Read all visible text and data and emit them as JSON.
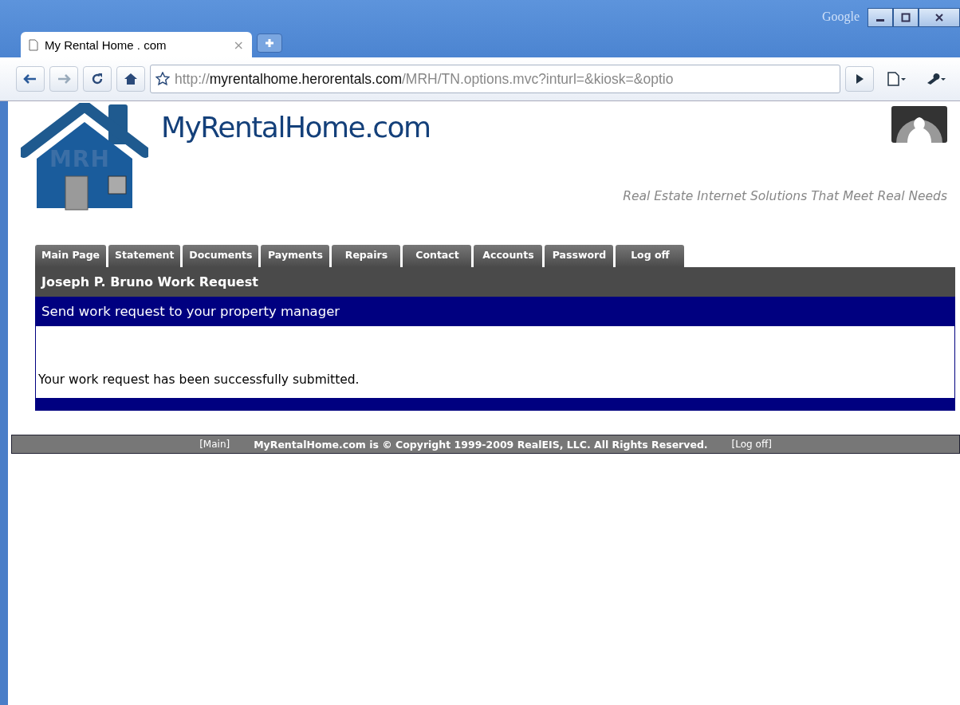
{
  "window": {
    "brand": "Google"
  },
  "tab": {
    "title": "My Rental Home . com",
    "close": "×"
  },
  "address": {
    "scheme": "http://",
    "host": "myrentalhome.herorentals.com",
    "path": "/MRH/TN.options.mvc?inturl=&kiosk=&optio"
  },
  "header": {
    "logo_mark": "MRH",
    "site_name": "MyRentalHome.com",
    "tagline": "Real Estate Internet Solutions That Meet Real Needs"
  },
  "nav_tabs": [
    {
      "label": "Main Page"
    },
    {
      "label": "Statement"
    },
    {
      "label": "Documents"
    },
    {
      "label": "Payments"
    },
    {
      "label": "Repairs"
    },
    {
      "label": "Contact"
    },
    {
      "label": "Accounts"
    },
    {
      "label": "Password"
    },
    {
      "label": "Log off"
    }
  ],
  "page_title": "Joseph P. Bruno Work Request",
  "section_title": "Send work request to your property manager",
  "message": "Your work request has been successfully submitted.",
  "footer": {
    "main_link": "[Main]",
    "copyright": "MyRentalHome.com is © Copyright 1999-2009 RealEIS, LLC. All Rights Reserved.",
    "logoff_link": "[Log off]"
  }
}
